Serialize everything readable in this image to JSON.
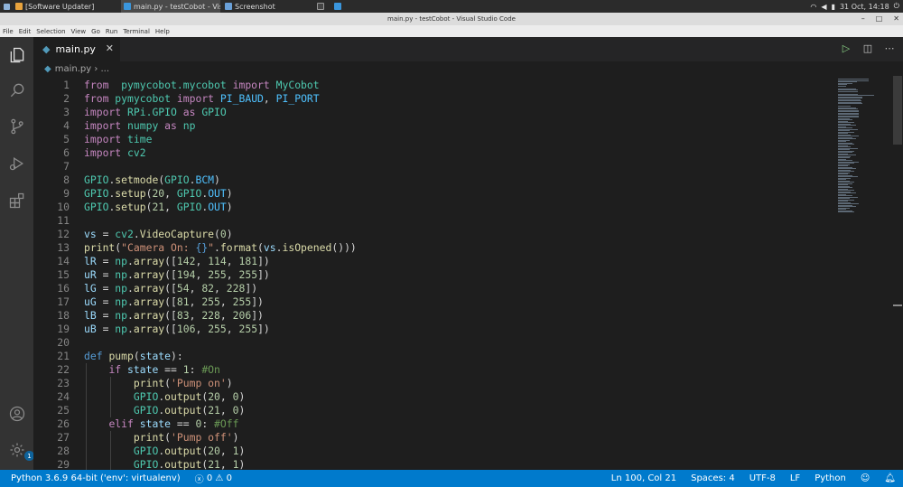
{
  "taskbar": {
    "tasks": [
      {
        "label": "[Software Updater]",
        "active": false,
        "icon_color": "#e8a33d"
      },
      {
        "label": "main.py - testCobot - Visual S...",
        "active": true,
        "icon_color": "#3a96dd"
      },
      {
        "label": "Screenshot",
        "active": false,
        "icon_color": "#6aa0d8"
      }
    ],
    "tray": {
      "clock": "31 Oct, 14:18"
    }
  },
  "window": {
    "title": "main.py - testCobot - Visual Studio Code"
  },
  "menu": [
    "File",
    "Edit",
    "Selection",
    "View",
    "Go",
    "Run",
    "Terminal",
    "Help"
  ],
  "activity_bar": {
    "items": [
      {
        "name": "explorer",
        "icon": "files-icon",
        "active": true
      },
      {
        "name": "search",
        "icon": "search-icon",
        "active": false
      },
      {
        "name": "source-control",
        "icon": "source-control-icon",
        "active": false
      },
      {
        "name": "run-debug",
        "icon": "run-debug-icon",
        "active": false
      },
      {
        "name": "extensions",
        "icon": "extensions-icon",
        "active": false
      }
    ],
    "bottom": {
      "accounts": "account-icon",
      "manage": "gear-icon",
      "manage_badge": "1"
    }
  },
  "tabs": [
    {
      "label": "main.py",
      "active": true
    }
  ],
  "breadcrumb": {
    "file": "main.py",
    "rest": "..."
  },
  "editor": {
    "start_line": 1,
    "lines": [
      [
        [
          "kw",
          "from"
        ],
        [
          "",
          "  "
        ],
        [
          "mod",
          "pymycobot.mycobot"
        ],
        [
          "",
          ""
        ],
        [
          "kw",
          " import"
        ],
        [
          "",
          " "
        ],
        [
          "mod",
          "MyCobot"
        ]
      ],
      [
        [
          "kw",
          "from"
        ],
        [
          "",
          " "
        ],
        [
          "mod",
          "pymycobot"
        ],
        [
          "kw",
          " import"
        ],
        [
          "",
          " "
        ],
        [
          "const",
          "PI_BAUD"
        ],
        [
          "",
          ", "
        ],
        [
          "const",
          "PI_PORT"
        ]
      ],
      [
        [
          "kw",
          "import"
        ],
        [
          "",
          " "
        ],
        [
          "mod",
          "RPi.GPIO"
        ],
        [
          "kw",
          " as"
        ],
        [
          "",
          " "
        ],
        [
          "mod",
          "GPIO"
        ]
      ],
      [
        [
          "kw",
          "import"
        ],
        [
          "",
          " "
        ],
        [
          "mod",
          "numpy"
        ],
        [
          "kw",
          " as"
        ],
        [
          "",
          " "
        ],
        [
          "mod",
          "np"
        ]
      ],
      [
        [
          "kw",
          "import"
        ],
        [
          "",
          " "
        ],
        [
          "mod",
          "time"
        ]
      ],
      [
        [
          "kw",
          "import"
        ],
        [
          "",
          " "
        ],
        [
          "mod",
          "cv2"
        ]
      ],
      [],
      [
        [
          "mod",
          "GPIO"
        ],
        [
          "",
          "."
        ],
        [
          "fn",
          "setmode"
        ],
        [
          "",
          "("
        ],
        [
          "mod",
          "GPIO"
        ],
        [
          "",
          "."
        ],
        [
          "const",
          "BCM"
        ],
        [
          "",
          ")"
        ]
      ],
      [
        [
          "mod",
          "GPIO"
        ],
        [
          "",
          "."
        ],
        [
          "fn",
          "setup"
        ],
        [
          "",
          "("
        ],
        [
          "num",
          "20"
        ],
        [
          "",
          ", "
        ],
        [
          "mod",
          "GPIO"
        ],
        [
          "",
          "."
        ],
        [
          "const",
          "OUT"
        ],
        [
          "",
          ")"
        ]
      ],
      [
        [
          "mod",
          "GPIO"
        ],
        [
          "",
          "."
        ],
        [
          "fn",
          "setup"
        ],
        [
          "",
          "("
        ],
        [
          "num",
          "21"
        ],
        [
          "",
          ", "
        ],
        [
          "mod",
          "GPIO"
        ],
        [
          "",
          "."
        ],
        [
          "const",
          "OUT"
        ],
        [
          "",
          ")"
        ]
      ],
      [],
      [
        [
          "var",
          "vs"
        ],
        [
          "",
          " = "
        ],
        [
          "mod",
          "cv2"
        ],
        [
          "",
          "."
        ],
        [
          "fn",
          "VideoCapture"
        ],
        [
          "",
          "("
        ],
        [
          "num",
          "0"
        ],
        [
          "",
          ")"
        ]
      ],
      [
        [
          "fn",
          "print"
        ],
        [
          "",
          "("
        ],
        [
          "str",
          "\"Camera On: "
        ],
        [
          "def",
          "{}"
        ],
        [
          "str",
          "\""
        ],
        [
          "",
          "."
        ],
        [
          "fn",
          "format"
        ],
        [
          "",
          "("
        ],
        [
          "var",
          "vs"
        ],
        [
          "",
          "."
        ],
        [
          "fn",
          "isOpened"
        ],
        [
          "",
          "()))"
        ]
      ],
      [
        [
          "var",
          "lR"
        ],
        [
          "",
          " = "
        ],
        [
          "mod",
          "np"
        ],
        [
          "",
          "."
        ],
        [
          "fn",
          "array"
        ],
        [
          "",
          "(["
        ],
        [
          "num",
          "142"
        ],
        [
          "",
          ", "
        ],
        [
          "num",
          "114"
        ],
        [
          "",
          ", "
        ],
        [
          "num",
          "181"
        ],
        [
          "",
          "])"
        ]
      ],
      [
        [
          "var",
          "uR"
        ],
        [
          "",
          " = "
        ],
        [
          "mod",
          "np"
        ],
        [
          "",
          "."
        ],
        [
          "fn",
          "array"
        ],
        [
          "",
          "(["
        ],
        [
          "num",
          "194"
        ],
        [
          "",
          ", "
        ],
        [
          "num",
          "255"
        ],
        [
          "",
          ", "
        ],
        [
          "num",
          "255"
        ],
        [
          "",
          "])"
        ]
      ],
      [
        [
          "var",
          "lG"
        ],
        [
          "",
          " = "
        ],
        [
          "mod",
          "np"
        ],
        [
          "",
          "."
        ],
        [
          "fn",
          "array"
        ],
        [
          "",
          "(["
        ],
        [
          "num",
          "54"
        ],
        [
          "",
          ", "
        ],
        [
          "num",
          "82"
        ],
        [
          "",
          ", "
        ],
        [
          "num",
          "228"
        ],
        [
          "",
          "])"
        ]
      ],
      [
        [
          "var",
          "uG"
        ],
        [
          "",
          " = "
        ],
        [
          "mod",
          "np"
        ],
        [
          "",
          "."
        ],
        [
          "fn",
          "array"
        ],
        [
          "",
          "(["
        ],
        [
          "num",
          "81"
        ],
        [
          "",
          ", "
        ],
        [
          "num",
          "255"
        ],
        [
          "",
          ", "
        ],
        [
          "num",
          "255"
        ],
        [
          "",
          "])"
        ]
      ],
      [
        [
          "var",
          "lB"
        ],
        [
          "",
          " = "
        ],
        [
          "mod",
          "np"
        ],
        [
          "",
          "."
        ],
        [
          "fn",
          "array"
        ],
        [
          "",
          "(["
        ],
        [
          "num",
          "83"
        ],
        [
          "",
          ", "
        ],
        [
          "num",
          "228"
        ],
        [
          "",
          ", "
        ],
        [
          "num",
          "206"
        ],
        [
          "",
          "])"
        ]
      ],
      [
        [
          "var",
          "uB"
        ],
        [
          "",
          " = "
        ],
        [
          "mod",
          "np"
        ],
        [
          "",
          "."
        ],
        [
          "fn",
          "array"
        ],
        [
          "",
          "(["
        ],
        [
          "num",
          "106"
        ],
        [
          "",
          ", "
        ],
        [
          "num",
          "255"
        ],
        [
          "",
          ", "
        ],
        [
          "num",
          "255"
        ],
        [
          "",
          "])"
        ]
      ],
      [],
      [
        [
          "def",
          "def"
        ],
        [
          "",
          " "
        ],
        [
          "fn",
          "pump"
        ],
        [
          "",
          "("
        ],
        [
          "var",
          "state"
        ],
        [
          "",
          "):"
        ]
      ],
      [
        [
          "",
          "    "
        ],
        [
          "kw",
          "if"
        ],
        [
          "",
          " "
        ],
        [
          "var",
          "state"
        ],
        [
          "",
          " == "
        ],
        [
          "num",
          "1"
        ],
        [
          "",
          ": "
        ],
        [
          "cmt",
          "#On"
        ]
      ],
      [
        [
          "",
          "        "
        ],
        [
          "fn",
          "print"
        ],
        [
          "",
          "("
        ],
        [
          "str",
          "'Pump on'"
        ],
        [
          "",
          ")"
        ]
      ],
      [
        [
          "",
          "        "
        ],
        [
          "mod",
          "GPIO"
        ],
        [
          "",
          "."
        ],
        [
          "fn",
          "output"
        ],
        [
          "",
          "("
        ],
        [
          "num",
          "20"
        ],
        [
          "",
          ", "
        ],
        [
          "num",
          "0"
        ],
        [
          "",
          ")"
        ]
      ],
      [
        [
          "",
          "        "
        ],
        [
          "mod",
          "GPIO"
        ],
        [
          "",
          "."
        ],
        [
          "fn",
          "output"
        ],
        [
          "",
          "("
        ],
        [
          "num",
          "21"
        ],
        [
          "",
          ", "
        ],
        [
          "num",
          "0"
        ],
        [
          "",
          ")"
        ]
      ],
      [
        [
          "",
          "    "
        ],
        [
          "kw",
          "elif"
        ],
        [
          "",
          " "
        ],
        [
          "var",
          "state"
        ],
        [
          "",
          " == "
        ],
        [
          "num",
          "0"
        ],
        [
          "",
          ": "
        ],
        [
          "cmt",
          "#Off"
        ]
      ],
      [
        [
          "",
          "        "
        ],
        [
          "fn",
          "print"
        ],
        [
          "",
          "("
        ],
        [
          "str",
          "'Pump off'"
        ],
        [
          "",
          ")"
        ]
      ],
      [
        [
          "",
          "        "
        ],
        [
          "mod",
          "GPIO"
        ],
        [
          "",
          "."
        ],
        [
          "fn",
          "output"
        ],
        [
          "",
          "("
        ],
        [
          "num",
          "20"
        ],
        [
          "",
          ", "
        ],
        [
          "num",
          "1"
        ],
        [
          "",
          ")"
        ]
      ],
      [
        [
          "",
          "        "
        ],
        [
          "mod",
          "GPIO"
        ],
        [
          "",
          "."
        ],
        [
          "fn",
          "output"
        ],
        [
          "",
          "("
        ],
        [
          "num",
          "21"
        ],
        [
          "",
          ", "
        ],
        [
          "num",
          "1"
        ],
        [
          "",
          ")"
        ]
      ]
    ]
  },
  "statusbar": {
    "interpreter": "Python 3.6.9 64-bit ('env': virtualenv)",
    "errors": "0",
    "warnings": "0",
    "cursor": "Ln 100, Col 21",
    "indent": "Spaces: 4",
    "encoding": "UTF-8",
    "eol": "LF",
    "language": "Python"
  }
}
